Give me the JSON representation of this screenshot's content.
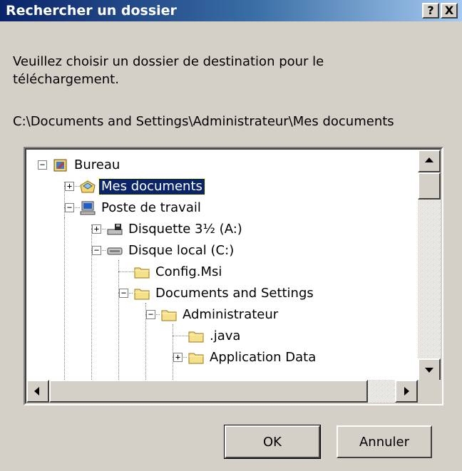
{
  "window": {
    "title": "Rechercher un dossier",
    "help_button": "?",
    "close_button": "X"
  },
  "instruction": "Veuillez choisir un dossier de destination pour le téléchargement.",
  "current_path": "C:\\Documents and Settings\\Administrateur\\Mes documents",
  "tree": [
    {
      "label": "Bureau",
      "icon": "desktop-icon",
      "expander": "−",
      "selected": false
    },
    {
      "label": "Mes documents",
      "icon": "my-documents-icon",
      "expander": "+",
      "selected": true
    },
    {
      "label": "Poste de travail",
      "icon": "my-computer-icon",
      "expander": "−",
      "selected": false
    },
    {
      "label": "Disquette 3½ (A:)",
      "icon": "floppy-drive-icon",
      "expander": "+",
      "selected": false
    },
    {
      "label": "Disque local (C:)",
      "icon": "hard-drive-icon",
      "expander": "−",
      "selected": false
    },
    {
      "label": "Config.Msi",
      "icon": "folder-icon",
      "expander": "",
      "selected": false
    },
    {
      "label": "Documents and Settings",
      "icon": "folder-icon",
      "expander": "−",
      "selected": false
    },
    {
      "label": "Administrateur",
      "icon": "folder-icon",
      "expander": "−",
      "selected": false
    },
    {
      "label": ".java",
      "icon": "folder-icon",
      "expander": "",
      "selected": false
    },
    {
      "label": "Application Data",
      "icon": "folder-icon",
      "expander": "+",
      "selected": false
    }
  ],
  "buttons": {
    "ok": "OK",
    "cancel": "Annuler"
  },
  "colors": {
    "title_bar": "#0a246a",
    "face": "#d4d0c8",
    "selection": "#0a246a"
  }
}
